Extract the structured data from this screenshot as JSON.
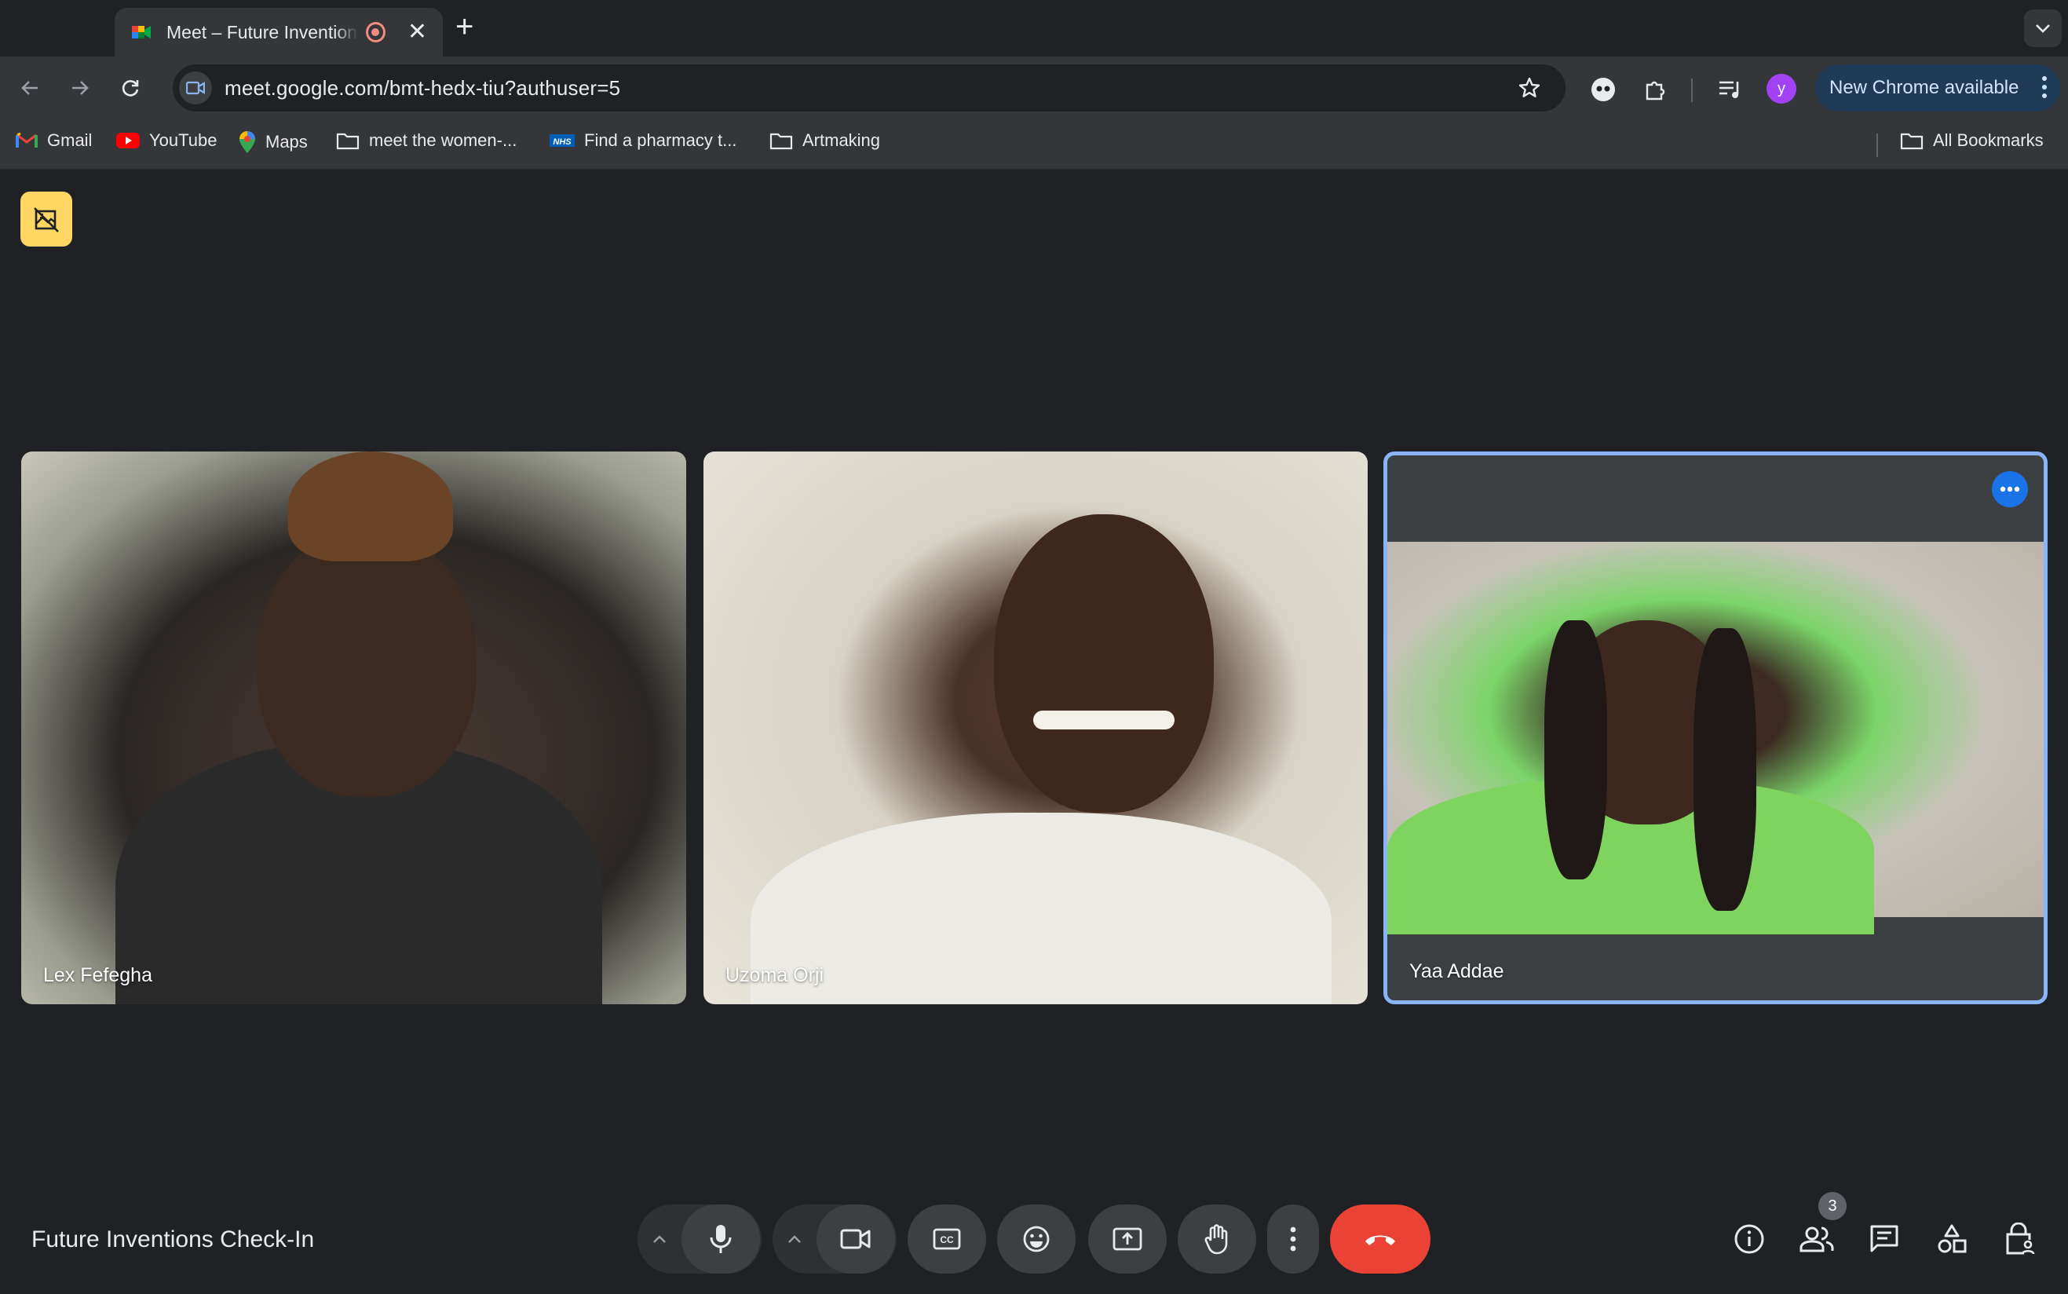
{
  "browser": {
    "tab": {
      "title": "Meet – Future Inventions Check-In"
    },
    "address_bar": {
      "url": "meet.google.com/bmt-hedx-tiu?authuser=5"
    },
    "profile_initial": "y",
    "update_chip": {
      "label": "New Chrome available"
    },
    "bookmarks": [
      {
        "label": "Gmail",
        "icon": "gmail-icon"
      },
      {
        "label": "YouTube",
        "icon": "youtube-icon"
      },
      {
        "label": "Maps",
        "icon": "maps-icon"
      },
      {
        "label": "meet the women-...",
        "icon": "folder-icon"
      },
      {
        "label": "Find a pharmacy t...",
        "icon": "nhs-icon"
      },
      {
        "label": "Artmaking",
        "icon": "folder-icon"
      }
    ],
    "all_bookmarks_label": "All Bookmarks"
  },
  "meet": {
    "meeting_title": "Future Inventions Check-In",
    "participants": [
      {
        "name": "Lex Fefegha"
      },
      {
        "name": "Uzoma Orji"
      },
      {
        "name": "Yaa Addae",
        "active_speaker": true
      }
    ],
    "people_count": "3",
    "colors": {
      "background": "#202124",
      "control": "#3c4043",
      "end_call": "#ea4335",
      "active_border": "#8ab4f8",
      "accent": "#1a73e8",
      "visibility_badge": "#fdd663"
    }
  }
}
